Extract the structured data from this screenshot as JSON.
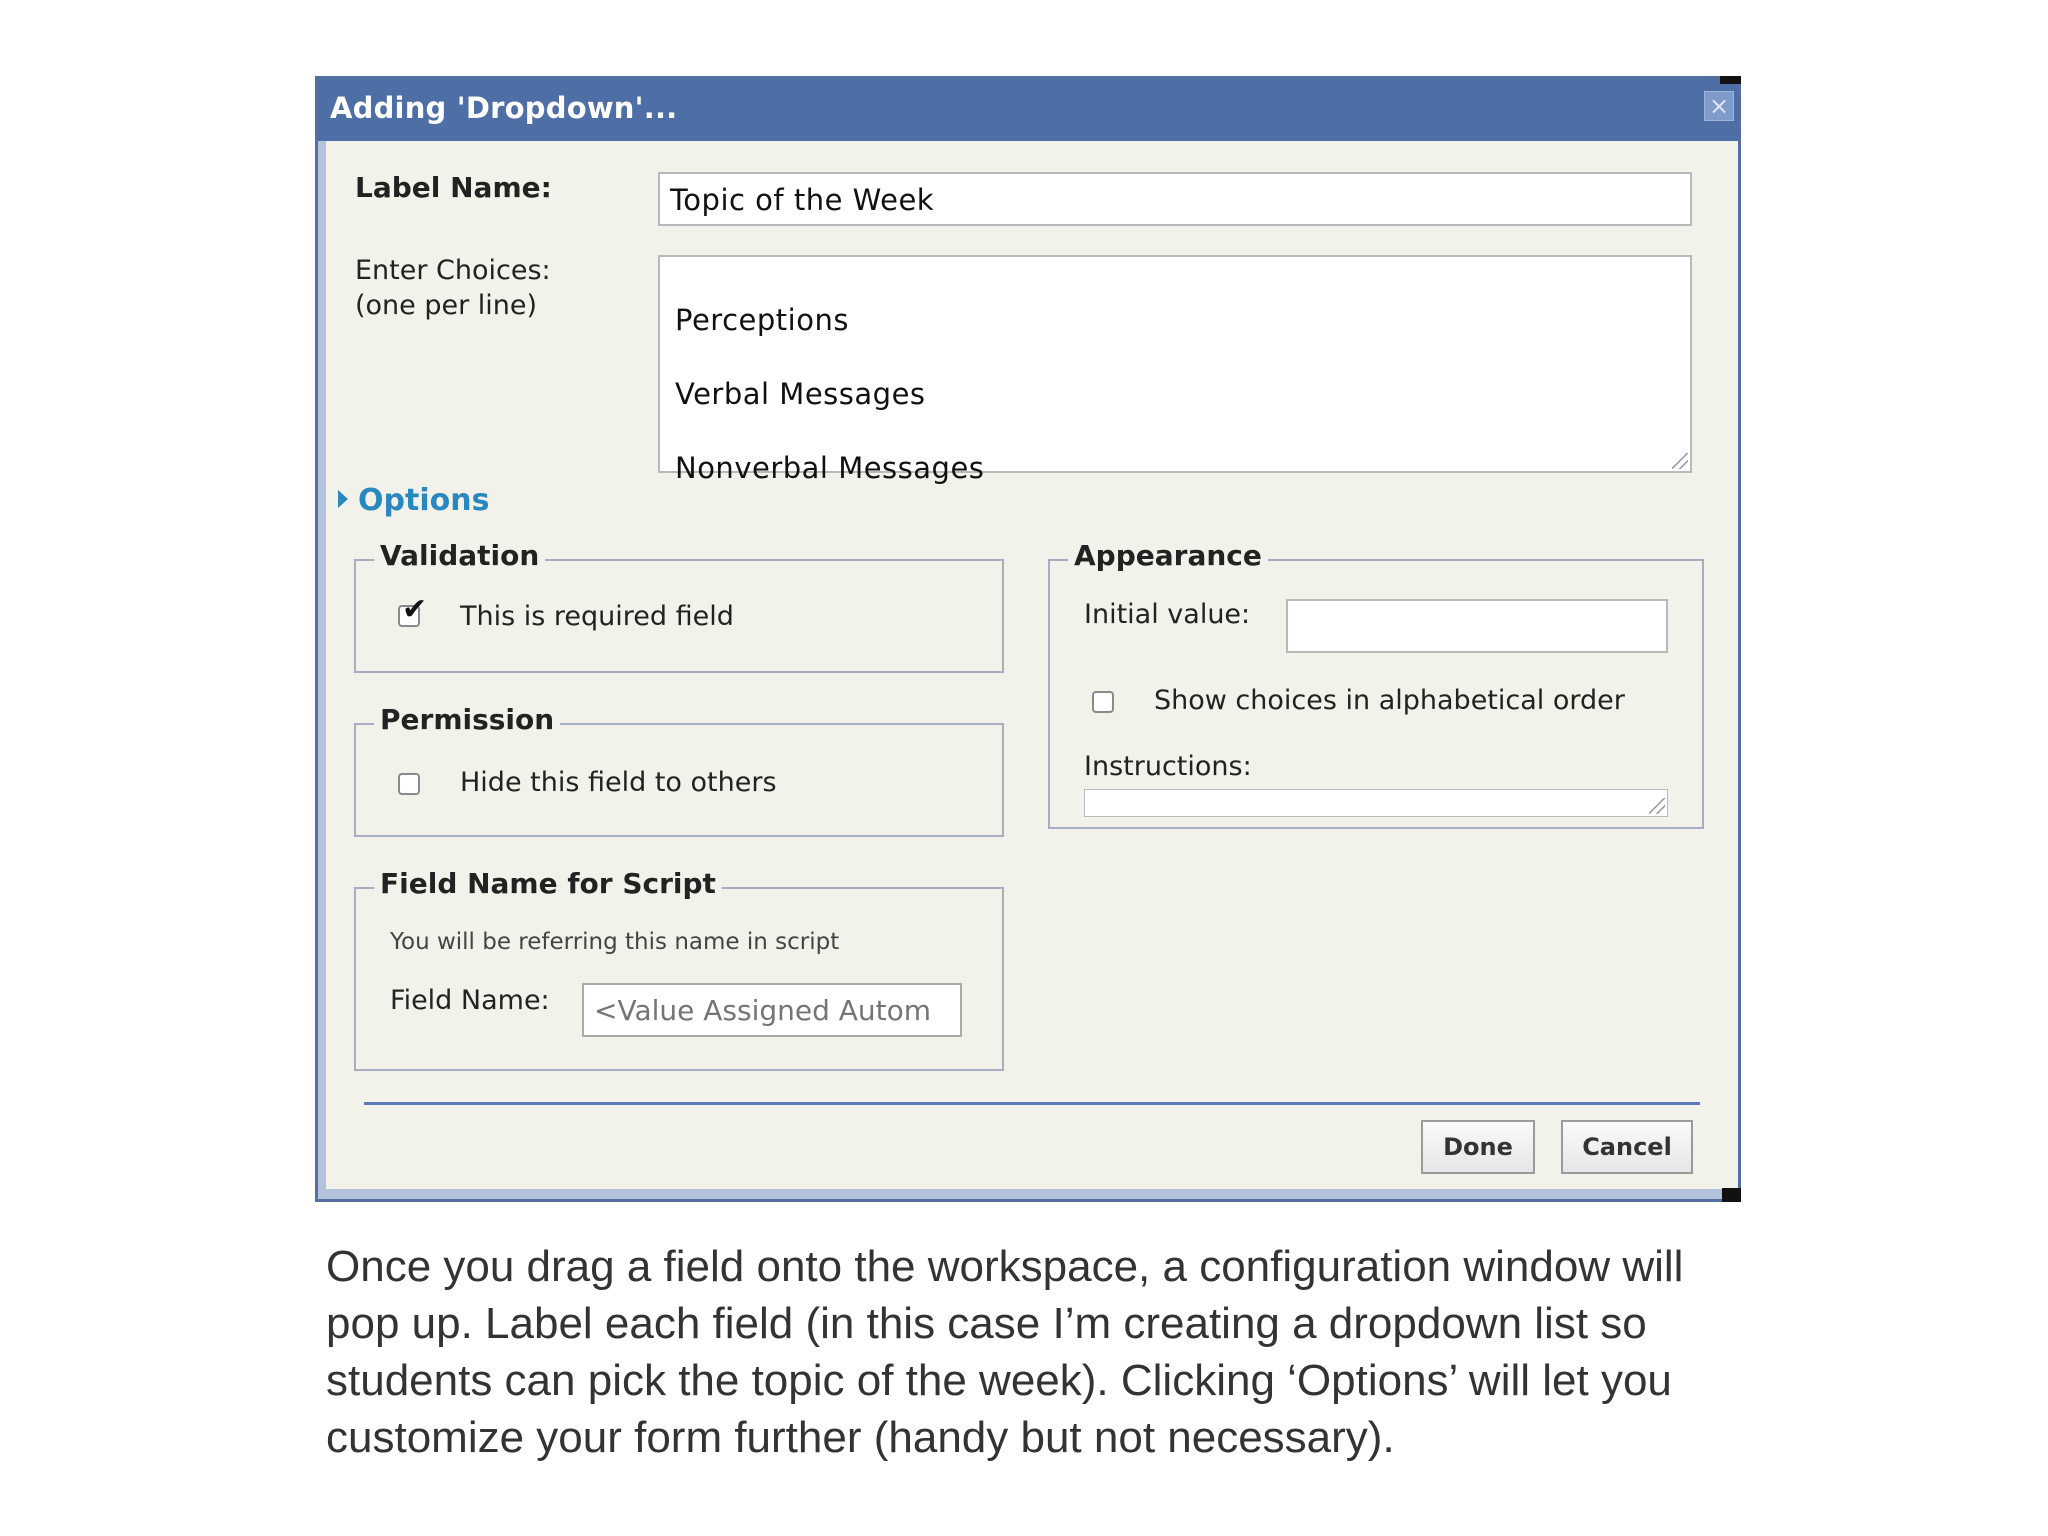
{
  "dialog": {
    "title": "Adding 'Dropdown'...",
    "close_label": "×",
    "label_name": {
      "label": "Label Name:",
      "value": "Topic of the Week"
    },
    "choices": {
      "label_line1": "Enter Choices:",
      "label_line2": "(one per line)",
      "lines": [
        "Perceptions",
        "Verbal Messages",
        "Nonverbal Messages"
      ]
    },
    "options_label": "Options",
    "validation": {
      "legend": "Validation",
      "checkbox_label": "This is required field",
      "checked": true
    },
    "permission": {
      "legend": "Permission",
      "checkbox_label": "Hide this field to others",
      "checked": false
    },
    "script": {
      "legend": "Field Name for Script",
      "hint": "You will be referring this name in script",
      "field_label": "Field Name:",
      "placeholder": "<Value Assigned Autom"
    },
    "appearance": {
      "legend": "Appearance",
      "initial_value_label": "Initial value:",
      "initial_value": "",
      "alphabetical_label": "Show choices in alphabetical order",
      "alphabetical_checked": false,
      "instructions_label": "Instructions:"
    },
    "buttons": {
      "done": "Done",
      "cancel": "Cancel"
    }
  },
  "caption": [
    "Once you drag a field onto the workspace, a configuration window will",
    "pop up. Label each field (in this case I’m creating a dropdown list so",
    "students can pick the topic of the week). Clicking ‘Options’ will let you",
    "customize your form further (handy but not necessary)."
  ],
  "colors": {
    "titlebar": "#4e6ea6",
    "options_link": "#2a88c0",
    "dialog_bg": "#f2f2ea"
  }
}
